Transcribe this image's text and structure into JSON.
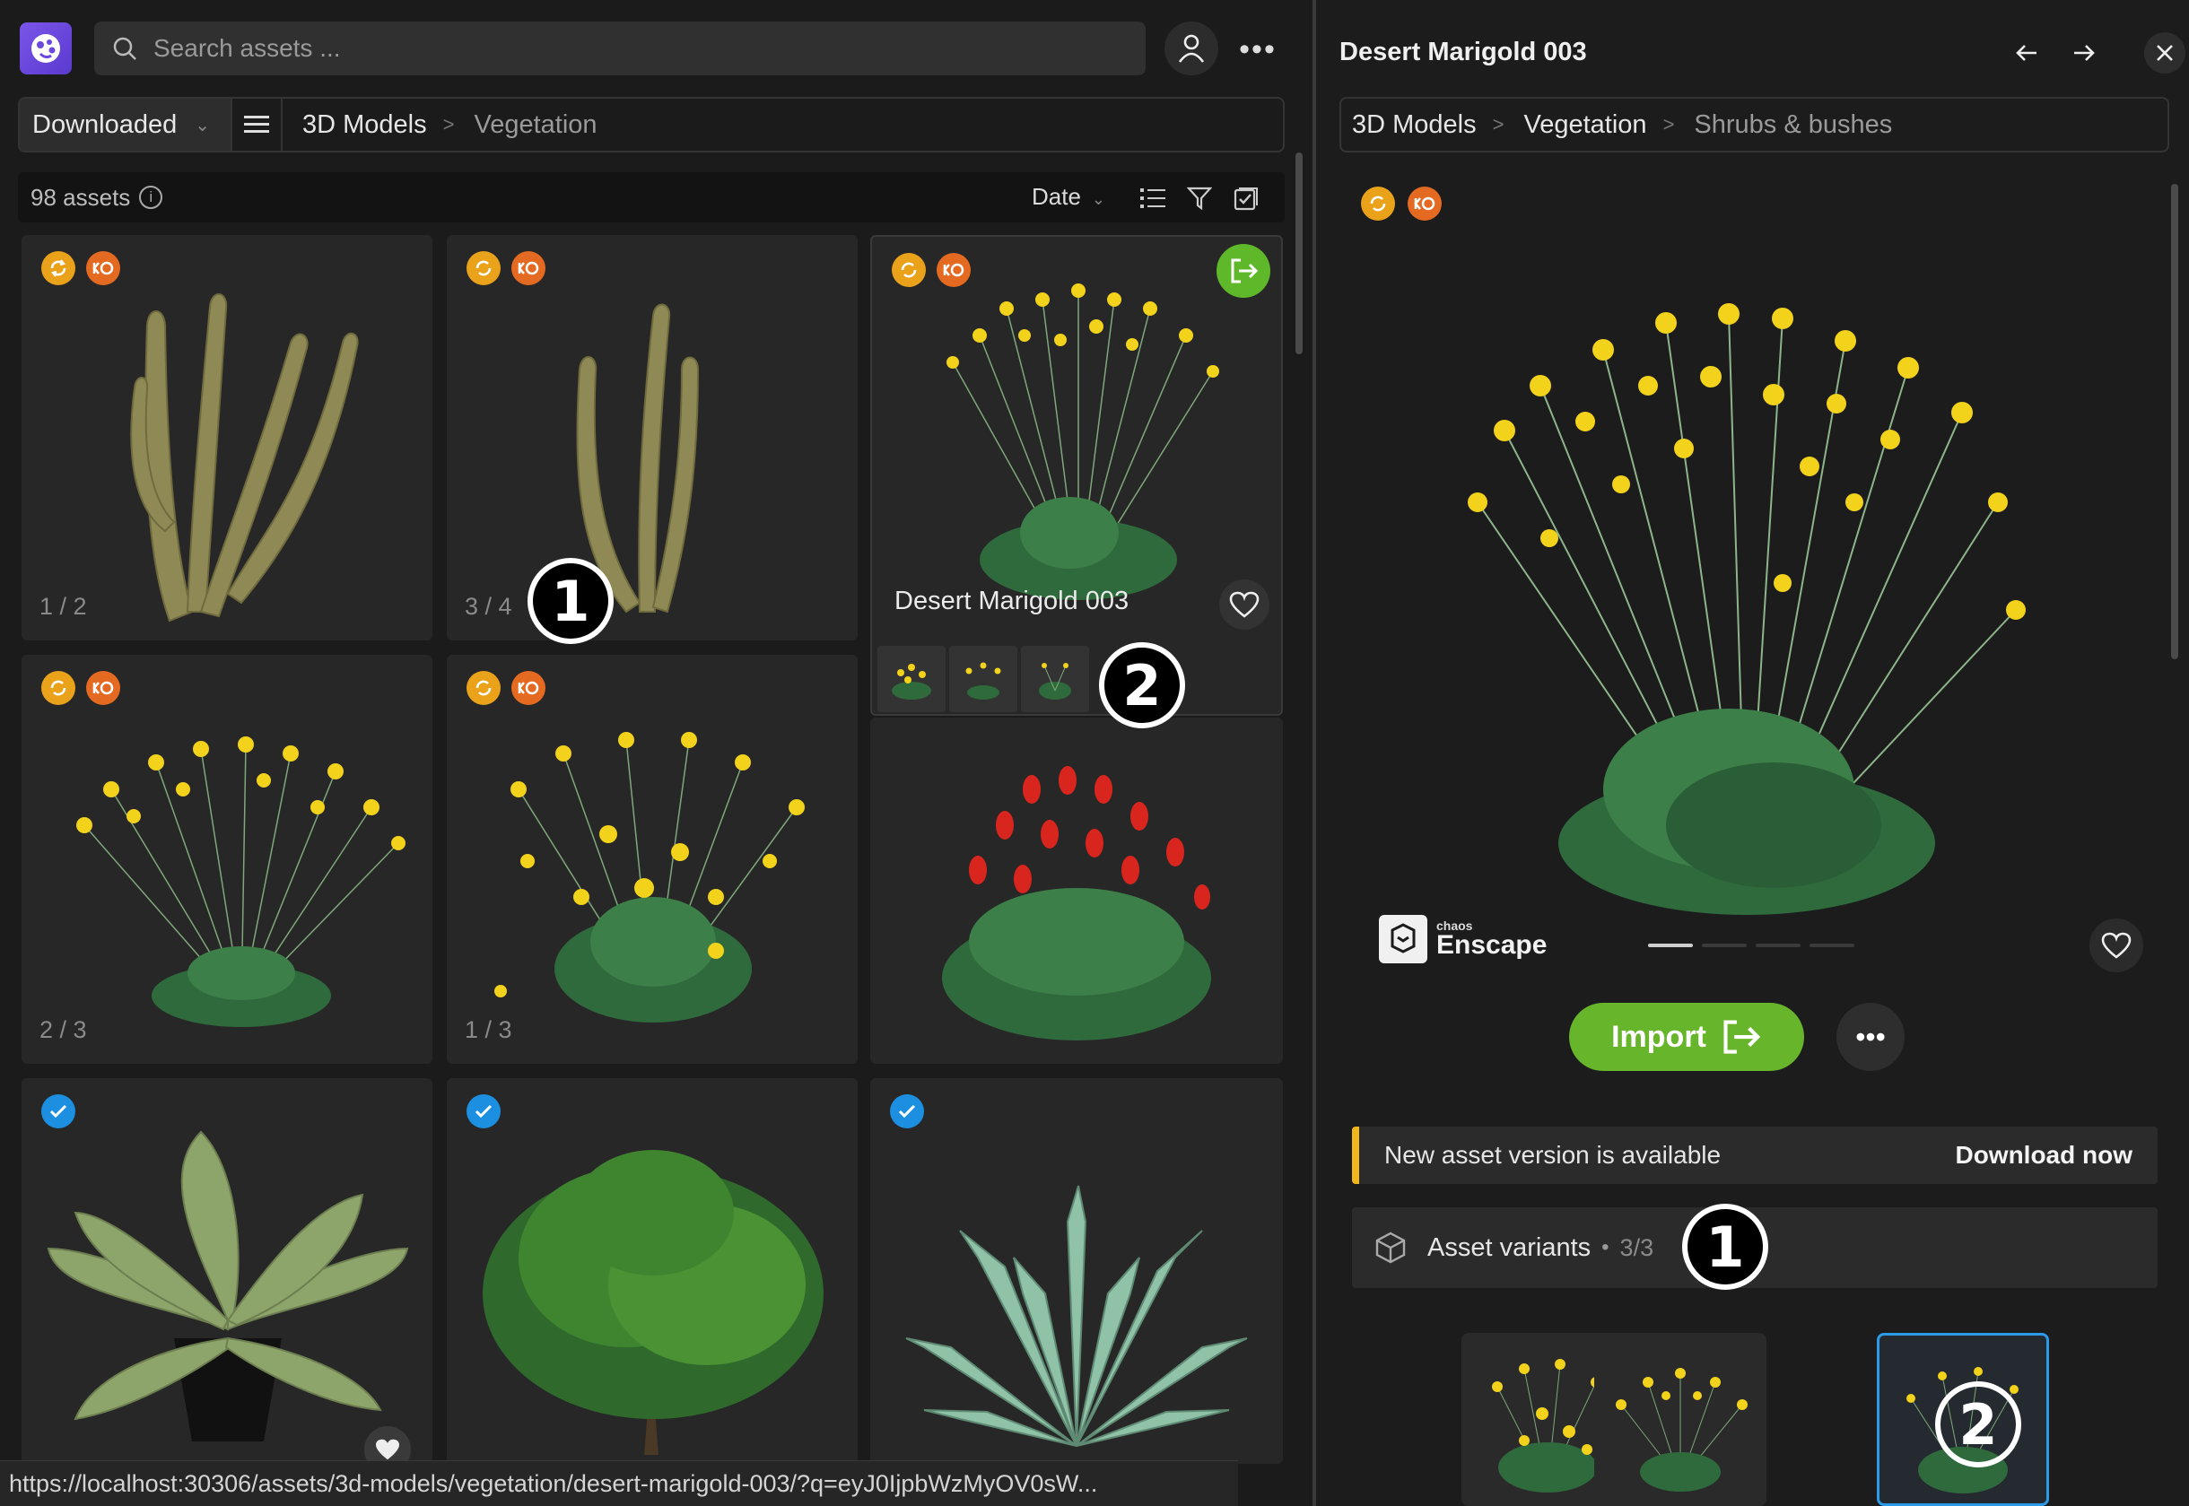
{
  "app": {
    "search_placeholder": "Search assets ...",
    "more_label": "•••"
  },
  "filter": {
    "dropdown_value": "Downloaded",
    "breadcrumbs": [
      "3D Models",
      "Vegetation"
    ]
  },
  "list": {
    "count": "98 assets",
    "sort": "Date"
  },
  "cards": [
    {
      "pager": "1 / 2"
    },
    {
      "pager": "3 / 4"
    },
    {
      "title": "Desert Marigold 003"
    },
    {
      "pager": "2 / 3"
    },
    {
      "pager": "1 / 3"
    },
    {},
    {},
    {},
    {}
  ],
  "annotations": {
    "one": "1",
    "two": "2"
  },
  "status_url": "https://localhost:30306/assets/3d-models/vegetation/desert-marigold-003/?q=eyJ0IjpbWzMyOV0sW...",
  "detail": {
    "title": "Desert Marigold 003",
    "breadcrumbs": [
      "3D Models",
      "Vegetation",
      "Shrubs & bushes"
    ],
    "brand_small": "chaos",
    "brand_large": "Enscape",
    "import_label": "Import",
    "more_label": "•••",
    "notice_message": "New asset version is available",
    "notice_action": "Download now",
    "variants_label": "Asset variants",
    "variants_bullet": "•",
    "variants_count": "3/3"
  },
  "colors": {
    "accent_green": "#67b52a",
    "notice_yellow": "#f0b61c",
    "badge_sync": "#e9a21a",
    "badge_ko": "#e46a22",
    "check_blue": "#1d8fe0",
    "flower_yellow": "#f2d21b",
    "flower_red": "#d8261e"
  },
  "icons": [
    "app-logo-icon",
    "search-icon",
    "user-icon",
    "more-icon",
    "chevron-down-icon",
    "list-menu-icon",
    "info-icon",
    "list-view-icon",
    "filter-icon",
    "select-icon",
    "sync-icon",
    "ko-icon",
    "check-icon",
    "import-icon",
    "heart-icon",
    "arrow-left-icon",
    "arrow-right-icon",
    "close-icon",
    "cube-icon"
  ]
}
